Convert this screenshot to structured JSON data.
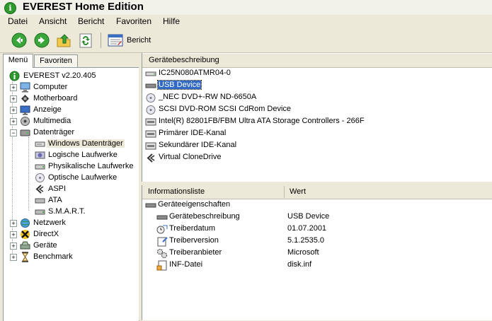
{
  "window": {
    "title": "EVEREST Home Edition"
  },
  "menu": [
    "Datei",
    "Ansicht",
    "Bericht",
    "Favoriten",
    "Hilfe"
  ],
  "toolbar": {
    "report_label": "Bericht"
  },
  "tabs": [
    {
      "label": "Menü",
      "active": true
    },
    {
      "label": "Favoriten",
      "active": false
    }
  ],
  "tree": {
    "root": "EVEREST v2.20.405",
    "items": [
      {
        "label": "Computer",
        "icon": "computer-icon",
        "expandable": true
      },
      {
        "label": "Motherboard",
        "icon": "motherboard-icon",
        "expandable": true
      },
      {
        "label": "Anzeige",
        "icon": "display-icon",
        "expandable": true
      },
      {
        "label": "Multimedia",
        "icon": "multimedia-icon",
        "expandable": true
      },
      {
        "label": "Datenträger",
        "icon": "storage-icon",
        "expandable": true,
        "expanded": true
      },
      {
        "label": "Windows Datenträger",
        "icon": "drive-icon",
        "child": true,
        "selected": true
      },
      {
        "label": "Logische Laufwerke",
        "icon": "logical-drive-icon",
        "child": true
      },
      {
        "label": "Physikalische Laufwerke",
        "icon": "physical-drive-icon",
        "child": true
      },
      {
        "label": "Optische Laufwerke",
        "icon": "optical-drive-icon",
        "child": true
      },
      {
        "label": "ASPI",
        "icon": "aspi-icon",
        "child": true
      },
      {
        "label": "ATA",
        "icon": "ata-icon",
        "child": true
      },
      {
        "label": "S.M.A.R.T.",
        "icon": "smart-icon",
        "child": true
      },
      {
        "label": "Netzwerk",
        "icon": "network-icon",
        "expandable": true
      },
      {
        "label": "DirectX",
        "icon": "directx-icon",
        "expandable": true
      },
      {
        "label": "Geräte",
        "icon": "devices-icon",
        "expandable": true
      },
      {
        "label": "Benchmark",
        "icon": "benchmark-icon",
        "expandable": true
      }
    ]
  },
  "device_list": {
    "header": "Gerätebeschreibung",
    "items": [
      {
        "label": "IC25N080ATMR04-0",
        "icon": "hard-disk-icon"
      },
      {
        "label": "USB Device",
        "icon": "usb-disk-icon",
        "selected": true
      },
      {
        "label": "_NEC DVD+-RW ND-6650A",
        "icon": "cd-drive-icon"
      },
      {
        "label": "SCSI DVD-ROM SCSI CdRom Device",
        "icon": "cd-drive-icon"
      },
      {
        "label": "Intel(R) 82801FB/FBM Ultra ATA Storage Controllers - 266F",
        "icon": "controller-icon"
      },
      {
        "label": "Primärer IDE-Kanal",
        "icon": "ide-channel-icon"
      },
      {
        "label": "Sekundärer IDE-Kanal",
        "icon": "ide-channel-icon"
      },
      {
        "label": "Virtual CloneDrive",
        "icon": "scsi-adapter-icon"
      }
    ]
  },
  "info": {
    "col_field": "Informationsliste",
    "col_value": "Wert",
    "group": "Geräteeigenschaften",
    "rows": [
      {
        "field": "Gerätebeschreibung",
        "value": "USB Device",
        "icon": "device-desc-icon"
      },
      {
        "field": "Treiberdatum",
        "value": "01.07.2001",
        "icon": "driver-date-icon"
      },
      {
        "field": "Treiberversion",
        "value": "5.1.2535.0",
        "icon": "driver-version-icon"
      },
      {
        "field": "Treiberanbieter",
        "value": "Microsoft",
        "icon": "driver-vendor-icon"
      },
      {
        "field": "INF-Datei",
        "value": "disk.inf",
        "icon": "inf-file-icon"
      }
    ]
  }
}
